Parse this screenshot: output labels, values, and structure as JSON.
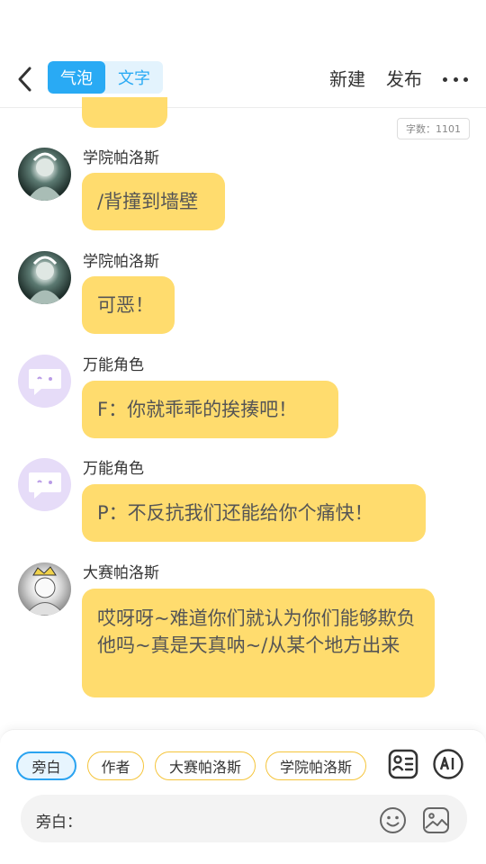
{
  "header": {
    "tabs": [
      {
        "label": "气泡",
        "active": true
      },
      {
        "label": "文字",
        "active": false
      }
    ],
    "new_label": "新建",
    "publish_label": "发布"
  },
  "word_count": "字数：1101",
  "messages": [
    {
      "name": "学院帕洛斯",
      "text": "/背撞到墙壁",
      "avatar": "dark-character-avatar"
    },
    {
      "name": "学院帕洛斯",
      "text": "可恶！",
      "avatar": "dark-character-avatar"
    },
    {
      "name": "万能角色",
      "text": "F：你就乖乖的挨揍吧！",
      "avatar": "chat-bubble-avatar"
    },
    {
      "name": "万能角色",
      "text": "P：不反抗我们还能给你个痛快！",
      "avatar": "chat-bubble-avatar"
    },
    {
      "name": "大赛帕洛斯",
      "text": "哎呀呀~难道你们就认为你们能够欺负他吗~真是天真呐~/从某个地方出来",
      "avatar": "light-character-avatar"
    }
  ],
  "chips": [
    {
      "label": "旁白",
      "active": true
    },
    {
      "label": "作者",
      "active": false
    },
    {
      "label": "大赛帕洛斯",
      "active": false
    },
    {
      "label": "学院帕洛斯",
      "active": false
    }
  ],
  "input": {
    "label": "旁白："
  },
  "colors": {
    "accent": "#29aaf4",
    "bubble": "#ffdc6e",
    "chip_border": "#f5c43a"
  },
  "icons": [
    "back-arrow-icon",
    "more-icon",
    "contact-card-icon",
    "ai-icon",
    "emoji-icon",
    "image-icon"
  ]
}
